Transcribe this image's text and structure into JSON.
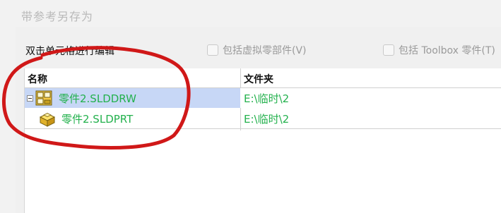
{
  "window": {
    "title": "带参考另存为"
  },
  "hint": "双击单元格进行编辑",
  "options": {
    "include_virtual": {
      "label": "包括虚拟零部件(V)",
      "checked": false
    },
    "include_toolbox": {
      "label": "包括 Toolbox 零件(T)",
      "checked": false
    }
  },
  "table": {
    "columns": [
      "名称",
      "文件夹"
    ],
    "rows": [
      {
        "name": "零件2.SLDDRW",
        "folder": "E:\\临时\\2",
        "icon": "drawing-icon",
        "selected": true,
        "expanded": true
      },
      {
        "name": "零件2.SLDPRT",
        "folder": "E:\\临时\\2",
        "icon": "part-icon",
        "selected": false
      }
    ]
  },
  "colors": {
    "filename_text": "#23b14d",
    "selected_row": "#c7d7f6",
    "annotation_stroke": "#d01818"
  }
}
